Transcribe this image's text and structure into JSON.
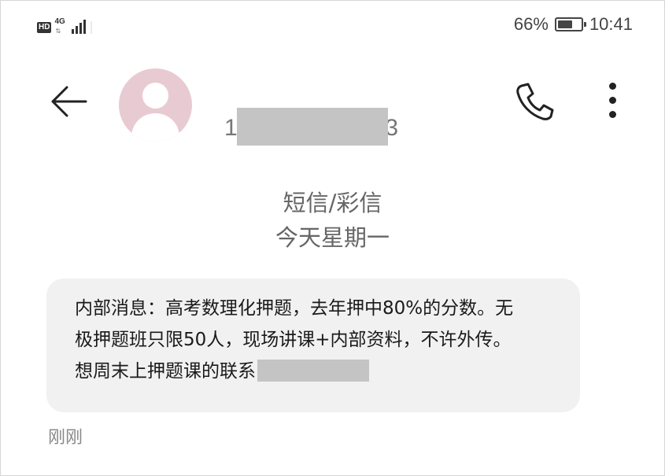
{
  "status_bar": {
    "hd": "HD",
    "network": "4G",
    "battery_percent": "66%",
    "battery_level": 0.66,
    "time": "10:41"
  },
  "header": {
    "back_icon": "arrow-left-icon",
    "avatar_icon": "person-icon",
    "contact_number_first": "1",
    "contact_number_last": "3",
    "call_icon": "phone-icon",
    "more_icon": "more-vertical-icon"
  },
  "meta": {
    "message_type": "短信/彩信",
    "date": "今天星期一"
  },
  "message": {
    "line1": "内部消息：高考数理化押题，去年押中80%的分数。无",
    "line2": "极押题班只限50人，现场讲课+内部资料，不许外传。",
    "line3": "想周末上押题课的联系",
    "timestamp": "刚刚"
  },
  "colors": {
    "avatar_bg": "#e8cbd2",
    "bubble_bg": "#f1f1f1",
    "redaction": "#c4c4c4",
    "meta_text": "#666666"
  }
}
